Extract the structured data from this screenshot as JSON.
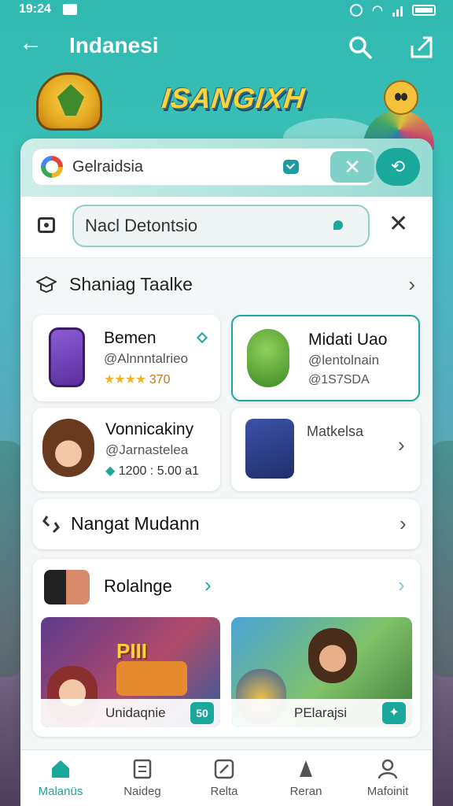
{
  "status": {
    "time": "19:24",
    "icons": [
      "gallery-icon",
      "alarm-icon",
      "wifi-icon",
      "signal-icon",
      "battery-icon"
    ]
  },
  "appbar": {
    "title": "Indanesi"
  },
  "hero": {
    "game_title": "ISANGIXH"
  },
  "search_primary": {
    "value": "Gelraidsia"
  },
  "search_secondary": {
    "value": "Nacl Detontsio"
  },
  "section_trending": {
    "label": "Shaniag Taalke"
  },
  "cards": [
    {
      "name": "Bemen",
      "handle": "@Alnnntalrieo",
      "stars": "★★★★",
      "rating": "370"
    },
    {
      "name": "Midati Uao",
      "handle": "@lentolnain",
      "meta": "@1S7SDA"
    },
    {
      "name": "Vonnicakiny",
      "handle": "@Jarnastelea",
      "meta": "1200 : 5.00 a1"
    },
    {
      "name": "Matkelsa"
    }
  ],
  "section_featured": {
    "label": "Nangat Mudann"
  },
  "section_promo": {
    "label": "Rolalnge",
    "tiles": [
      {
        "title": "Unidaqnie",
        "badge": "50",
        "game_text": "PIII"
      },
      {
        "title": "PElarajsi"
      }
    ]
  },
  "nav": [
    {
      "label": "Malanüs",
      "icon": "home-icon"
    },
    {
      "label": "Naideg",
      "icon": "list-icon"
    },
    {
      "label": "Relta",
      "icon": "compass-icon"
    },
    {
      "label": "Reran",
      "icon": "bell-icon"
    },
    {
      "label": "Mafoinit",
      "icon": "profile-icon"
    }
  ],
  "colors": {
    "accent": "#1aa79c",
    "header_bg": "#2fb9b1",
    "star": "#f0b429"
  }
}
